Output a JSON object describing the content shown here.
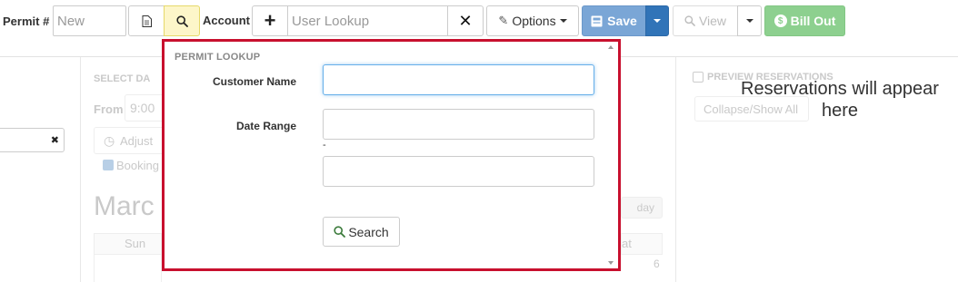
{
  "toolbar": {
    "permit_label": "Permit #",
    "permit_placeholder": "New",
    "account_label": "Account",
    "account_placeholder": "User Lookup",
    "options_label": "Options",
    "save_label": "Save",
    "view_label": "View",
    "bill_out_label": "Bill Out",
    "colors": {
      "save": "#7aa6d6",
      "save_caret": "#3174b8",
      "bill_out": "#8dd08f",
      "lookup_active": "#fdf6c9"
    }
  },
  "background": {
    "select_date_label": "SELECT DA",
    "from_label": "From",
    "from_value": "9:00",
    "adjust_label": "Adjust",
    "booking_label": "Booking",
    "month_title": "Marc",
    "day_button": "day",
    "sun_label": "Sun",
    "sat_label": "at",
    "day_number": "6",
    "preview_label": "PREVIEW RESERVATIONS",
    "collapse_label": "Collapse/Show All",
    "reservations_message": "Reservations will appear here"
  },
  "popup": {
    "title": "PERMIT LOOKUP",
    "customer_name_label": "Customer Name",
    "date_range_label": "Date Range",
    "range_separator": "-",
    "search_label": "Search",
    "border_color": "#c8102e"
  }
}
